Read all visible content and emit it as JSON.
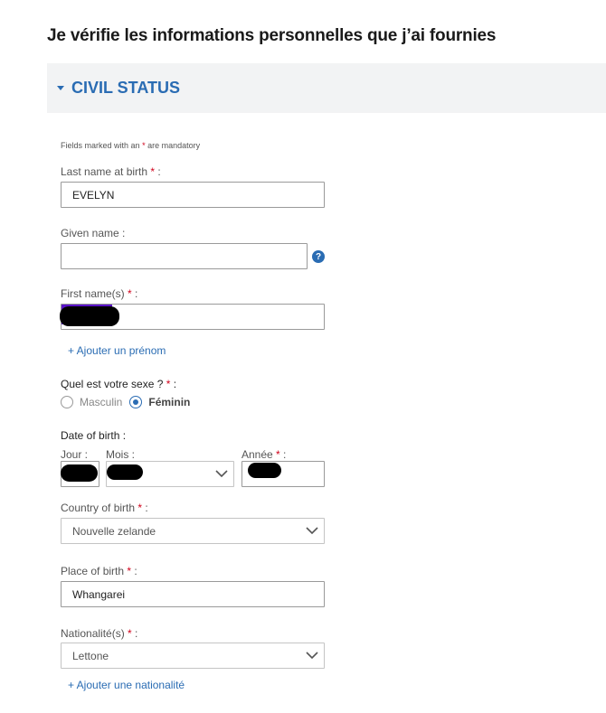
{
  "page": {
    "title": "Je vérifie les informations personnelles que j’ai fournies"
  },
  "section": {
    "title": "CIVIL STATUS"
  },
  "form": {
    "mandatory_note_prefix": "Fields marked with an",
    "mandatory_note_star": "*",
    "mandatory_note_suffix": "are mandatory",
    "required_star": "*",
    "last_name": {
      "label": "Last name at birth",
      "value": "EVELYN"
    },
    "given_name": {
      "label": "Given name :",
      "value": "",
      "help_icon": "?"
    },
    "first_names": {
      "label": "First name(s)",
      "value": "",
      "add_link": "+ Ajouter un prénom"
    },
    "sex": {
      "label": "Quel est votre sexe ?",
      "options": [
        "Masculin",
        "Féminin"
      ],
      "selected": "Féminin"
    },
    "dob": {
      "label": "Date of birth :",
      "day_label": "Jour :",
      "month_label": "Mois :",
      "year_label": "Année",
      "year_suffix": " :"
    },
    "country_of_birth": {
      "label": "Country of birth",
      "value": "Nouvelle zelande"
    },
    "place_of_birth": {
      "label": "Place of birth",
      "value": "Whangarei"
    },
    "nationality": {
      "label": "Nationalité(s)",
      "value": "Lettone",
      "add_link": "+ Ajouter une nationalité"
    },
    "colon": " :"
  },
  "colors": {
    "accent": "#2a6cb3",
    "required": "#d0021b",
    "header_bg": "#f2f3f4"
  }
}
